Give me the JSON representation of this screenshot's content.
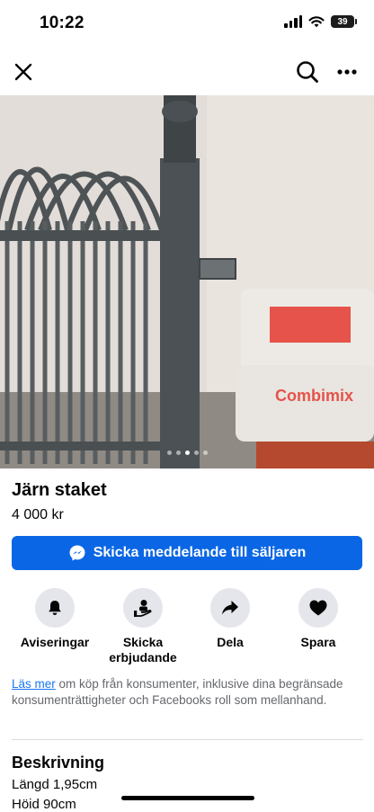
{
  "status_bar": {
    "time": "10:22",
    "battery": "39"
  },
  "nav": {
    "close_icon": "close-icon",
    "search_icon": "search-icon",
    "more_icon": "more-icon"
  },
  "image": {
    "pages": 5,
    "active_page": 3,
    "bag_text": "Combimix"
  },
  "listing": {
    "title": "Järn staket",
    "price": "4 000 kr"
  },
  "message_button": {
    "label": "Skicka meddelande till säljaren",
    "icon": "messenger-icon",
    "color": "#0a66e4"
  },
  "actions": [
    {
      "label": "Aviseringar",
      "icon": "bell-icon"
    },
    {
      "label": "Skicka erbjudande",
      "icon": "offer-icon"
    },
    {
      "label": "Dela",
      "icon": "share-icon"
    },
    {
      "label": "Spara",
      "icon": "heart-icon"
    }
  ],
  "legal": {
    "link": "Läs mer",
    "text": " om köp från konsumenter, inklusive dina begränsade konsumenträttigheter och Facebooks roll som mellanhand."
  },
  "description": {
    "heading": "Beskrivning",
    "lines": [
      "Längd 1,95cm",
      "Höid 90cm"
    ]
  }
}
